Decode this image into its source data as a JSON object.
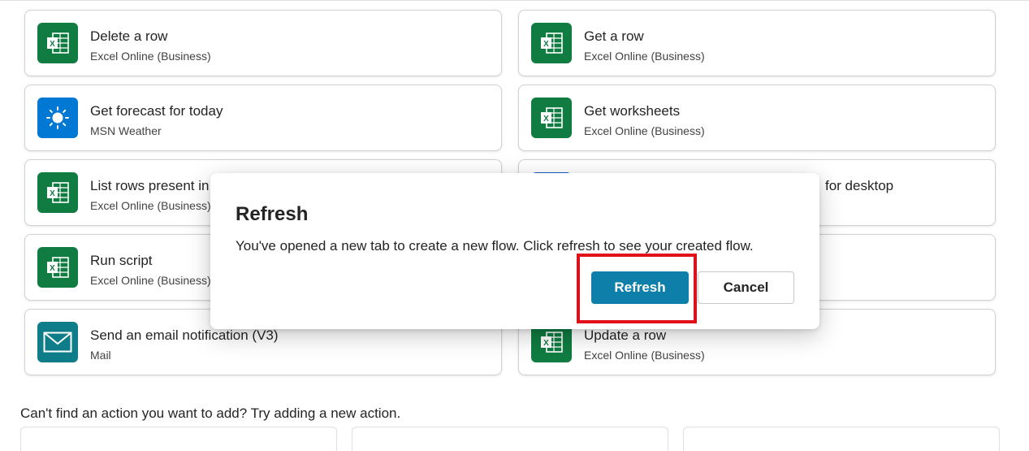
{
  "actions": [
    {
      "title": "Delete a row",
      "connector": "Excel Online (Business)",
      "icon": "excel-icon"
    },
    {
      "title": "Get a row",
      "connector": "Excel Online (Business)",
      "icon": "excel-icon"
    },
    {
      "title": "Get forecast for today",
      "connector": "MSN Weather",
      "icon": "sun-icon"
    },
    {
      "title": "Get worksheets",
      "connector": "Excel Online (Business)",
      "icon": "excel-icon"
    },
    {
      "title": "List rows present in",
      "connector": "Excel Online (Business)",
      "icon": "excel-icon"
    },
    {
      "title": "for desktop",
      "connector": "",
      "icon": "desktop-flow-icon"
    },
    {
      "title": "Run script",
      "connector": "Excel Online (Business)",
      "icon": "excel-icon"
    },
    {
      "title": "",
      "connector": "",
      "icon": ""
    },
    {
      "title": "Send an email notification (V3)",
      "connector": "Mail",
      "icon": "mail-icon"
    },
    {
      "title": "Update a row",
      "connector": "Excel Online (Business)",
      "icon": "excel-icon"
    }
  ],
  "hint_text": "Can't find an action you want to add? Try adding a new action.",
  "dialog": {
    "title": "Refresh",
    "body": "You've opened a new tab to create a new flow. Click refresh to see your created flow.",
    "primary_label": "Refresh",
    "secondary_label": "Cancel"
  },
  "colors": {
    "excel": "#107c41",
    "weather": "#0078d4",
    "mail": "#0f7c8a",
    "primary_button": "#0e7fa8",
    "highlight": "#e0101a"
  }
}
